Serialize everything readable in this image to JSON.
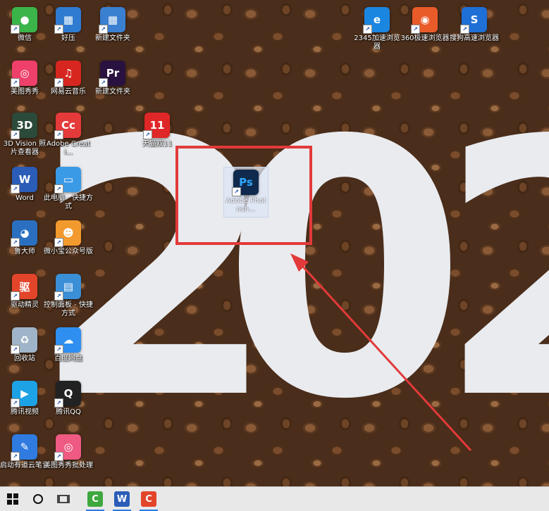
{
  "wallpaper": {
    "text": "202"
  },
  "desktop_icons": [
    {
      "label": "微信",
      "icon": "wechat-icon",
      "color": "#3bb44a",
      "glyph": "●",
      "col": 0,
      "row": 0
    },
    {
      "label": "好压",
      "icon": "haozip-icon",
      "color": "#2f7bd1",
      "glyph": "▦",
      "col": 1,
      "row": 0
    },
    {
      "label": "新建文件夹",
      "icon": "archive-folder-icon",
      "color": "#3a7fd0",
      "glyph": "▦",
      "col": 2,
      "row": 0
    },
    {
      "label": "2345加速浏览器",
      "icon": "browser-2345-icon",
      "color": "#1b86e0",
      "glyph": "e",
      "col": 7,
      "row": 0
    },
    {
      "label": "360极速浏览器",
      "icon": "browser-360-icon",
      "color": "#ea5b2a",
      "glyph": "◉",
      "col": 8,
      "row": 0
    },
    {
      "label": "搜狗高速浏览器",
      "icon": "browser-sogou-icon",
      "color": "#1e6fd6",
      "glyph": "S",
      "col": 9,
      "row": 0
    },
    {
      "label": "美图秀秀",
      "icon": "meitu-icon",
      "color": "#ef3f6b",
      "glyph": "◎",
      "col": 0,
      "row": 1
    },
    {
      "label": "网易云音乐",
      "icon": "netease-music-icon",
      "color": "#d7261f",
      "glyph": "♫",
      "col": 1,
      "row": 1
    },
    {
      "label": "新建文件夹",
      "icon": "premiere-folder-icon",
      "color": "#2a1240",
      "glyph": "Pr",
      "col": 2,
      "row": 1
    },
    {
      "label": "3D Vision 照片查看器",
      "icon": "3d-vision-icon",
      "color": "#2b4a3a",
      "glyph": "3D",
      "col": 0,
      "row": 2
    },
    {
      "label": "Adobe Creati...",
      "icon": "adobe-cc-icon",
      "color": "#e43a3a",
      "glyph": "Cc",
      "col": 1,
      "row": 2
    },
    {
      "label": "天猫双11",
      "icon": "tmall-icon",
      "color": "#e02727",
      "glyph": "11",
      "col": 3,
      "row": 2
    },
    {
      "label": "Word",
      "icon": "word-icon",
      "color": "#2b5cb8",
      "glyph": "W",
      "col": 0,
      "row": 3
    },
    {
      "label": "此电脑 - 快捷方式",
      "icon": "this-pc-icon",
      "color": "#3b9ae6",
      "glyph": "▭",
      "col": 1,
      "row": 3
    },
    {
      "label": "鲁大师",
      "icon": "ludashi-icon",
      "color": "#2b6fc0",
      "glyph": "◕",
      "col": 0,
      "row": 4
    },
    {
      "label": "微小宝公众号版",
      "icon": "weixiaobao-icon",
      "color": "#f29a2e",
      "glyph": "☻",
      "col": 1,
      "row": 4
    },
    {
      "label": "驱动精灵",
      "icon": "driver-genius-icon",
      "color": "#e2452a",
      "glyph": "驱",
      "col": 0,
      "row": 5
    },
    {
      "label": "控制面板 - 快捷方式",
      "icon": "control-panel-icon",
      "color": "#3a8fd6",
      "glyph": "▤",
      "col": 1,
      "row": 5
    },
    {
      "label": "回收站",
      "icon": "recycle-bin-icon",
      "color": "#9fb4c8",
      "glyph": "♻",
      "col": 0,
      "row": 6
    },
    {
      "label": "百度网盘",
      "icon": "baidu-netdisk-icon",
      "color": "#2e8ff0",
      "glyph": "☁",
      "col": 1,
      "row": 6
    },
    {
      "label": "腾讯视频",
      "icon": "tencent-video-icon",
      "color": "#1ea2e6",
      "glyph": "▶",
      "col": 0,
      "row": 7
    },
    {
      "label": "腾讯QQ",
      "icon": "qq-icon",
      "color": "#222222",
      "glyph": "Q",
      "col": 1,
      "row": 7
    },
    {
      "label": "启动有道云笔记",
      "icon": "youdao-note-icon",
      "color": "#2f7be0",
      "glyph": "✎",
      "col": 0,
      "row": 8
    },
    {
      "label": "美图秀秀批处理",
      "icon": "meitu-batch-icon",
      "color": "#ee5a82",
      "glyph": "◎",
      "col": 1,
      "row": 8
    }
  ],
  "selected_icon": {
    "label": "Adobe Photosh...",
    "icon": "photoshop-icon",
    "color": "#0f2a4d",
    "glyph": "Ps"
  },
  "taskbar": {
    "start_icon": "windows-start-icon",
    "search_icon": "cortana-circle-icon",
    "taskview_icon": "task-view-icon",
    "apps": [
      {
        "icon": "camtasia-green-icon",
        "color": "#3ea83e",
        "glyph": "C",
        "active": true
      },
      {
        "icon": "word-taskbar-icon",
        "color": "#2b5cb8",
        "glyph": "W",
        "active": true
      },
      {
        "icon": "camtasia-red-icon",
        "color": "#e2452a",
        "glyph": "C",
        "active": true
      }
    ]
  }
}
